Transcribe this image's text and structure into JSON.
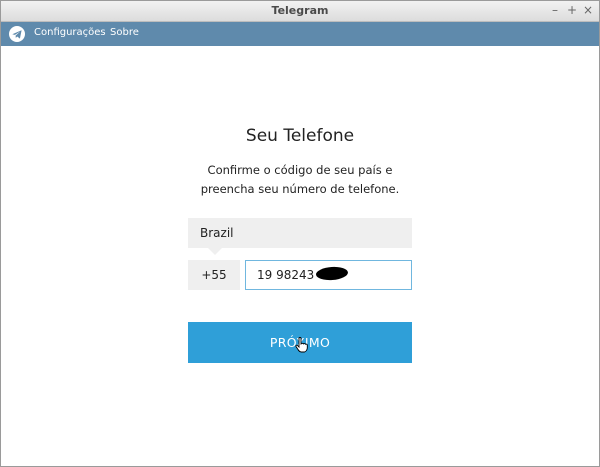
{
  "window": {
    "title": "Telegram",
    "controls": {
      "minimize": "–",
      "maximize": "+",
      "close": "×"
    }
  },
  "menubar": {
    "items": [
      {
        "label": "Configurações"
      },
      {
        "label": "Sobre"
      }
    ],
    "logo_icon": "telegram-logo-icon"
  },
  "login": {
    "heading": "Seu Telefone",
    "description_line1": "Confirme o código de seu país e",
    "description_line2": "preencha seu número de telefone.",
    "country": "Brazil",
    "country_code": "+55",
    "phone_number": "19 98243",
    "next_button": "PRÓXIMO"
  },
  "colors": {
    "menubar_bg": "#5f8aac",
    "button_bg": "#2f9fd8",
    "field_bg": "#efefef",
    "focus_border": "#70b7df"
  }
}
